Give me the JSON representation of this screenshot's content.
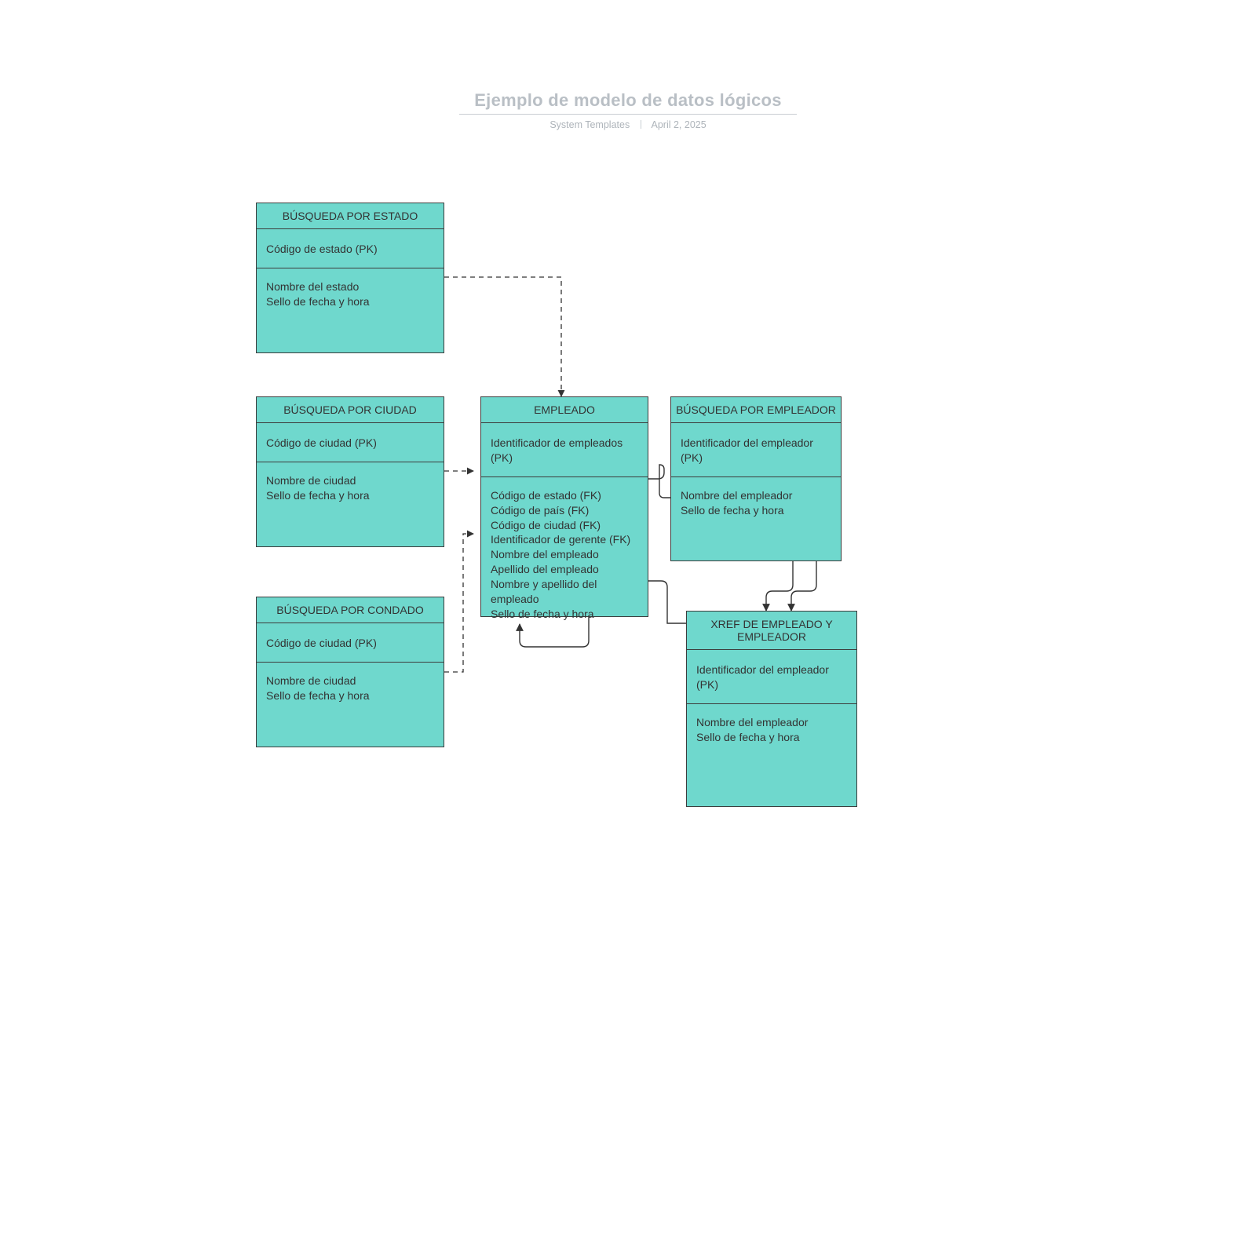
{
  "header": {
    "title": "Ejemplo de modelo de datos lógicos",
    "author": "System Templates",
    "date": "April 2, 2025"
  },
  "entities": {
    "estado": {
      "title": "BÚSQUEDA POR ESTADO",
      "pk": "Código de estado (PK)",
      "attrs": "Nombre del estado\nSello de fecha y hora"
    },
    "ciudad": {
      "title": "BÚSQUEDA POR CIUDAD",
      "pk": "Código de ciudad (PK)",
      "attrs": "Nombre de ciudad\nSello de fecha y hora"
    },
    "condado": {
      "title": "BÚSQUEDA POR CONDADO",
      "pk": "Código de ciudad (PK)",
      "attrs": "Nombre de ciudad\nSello de fecha y hora"
    },
    "empleado": {
      "title": "EMPLEADO",
      "pk": "Identificador de empleados (PK)",
      "attrs": "Código de estado (FK)\nCódigo de país (FK)\nCódigo de ciudad (FK)\nIdentificador de gerente (FK)\nNombre del empleado\nApellido del empleado\nNombre y apellido del empleado\nSello de fecha y hora"
    },
    "empleador": {
      "title": "BÚSQUEDA POR EMPLEADOR",
      "pk": "Identificador del empleador (PK)",
      "attrs": "Nombre del empleador\nSello de fecha y hora"
    },
    "xref": {
      "title": "XREF DE EMPLEADO Y EMPLEADOR",
      "pk": "Identificador del empleador (PK)",
      "attrs": "Nombre del empleador\nSello de fecha y hora"
    }
  }
}
